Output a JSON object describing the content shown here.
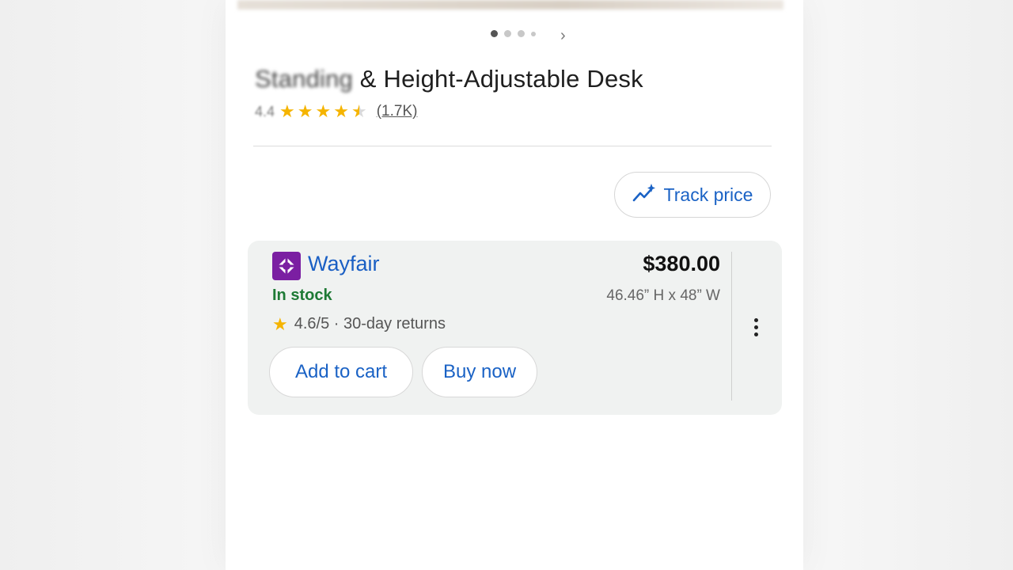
{
  "product": {
    "title_prefix": "Standing",
    "title_rest": " & Height-Adjustable Desk",
    "rating": "4.4",
    "review_count": "(1.7K)",
    "star_value": 4.4,
    "carousel": {
      "total": 4,
      "active": 0
    }
  },
  "track": {
    "label": "Track price",
    "icon": "trend-sparkle-icon"
  },
  "offer": {
    "merchant": "Wayfair",
    "merchant_icon": "wayfair-logo-icon",
    "stock": "In stock",
    "seller_rating": "4.6/5 · 30-day returns",
    "price": "$380.00",
    "dimensions": "46.46” H x 48” W",
    "add_to_cart": "Add to cart",
    "buy_now": "Buy now"
  },
  "colors": {
    "accent_blue": "#1a62c5",
    "stock_green": "#1e7a35",
    "star_gold": "#f5b400",
    "wayfair_purple": "#7b1fa2"
  }
}
